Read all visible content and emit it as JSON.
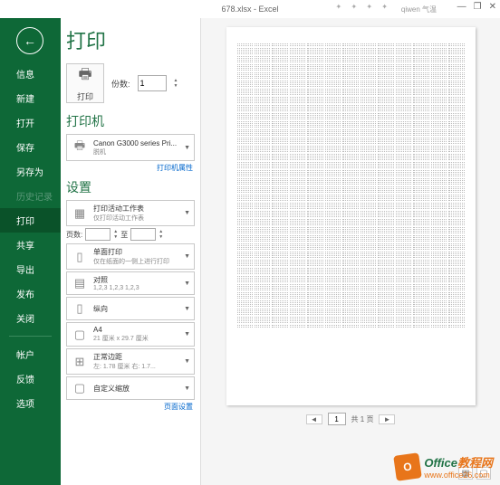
{
  "titlebar": {
    "filename": "678.xlsx - Excel",
    "user": "qiwen 气温"
  },
  "window": {
    "minimize": "—",
    "restore": "❐",
    "close": "✕"
  },
  "sidebar": {
    "items": [
      "信息",
      "新建",
      "打开",
      "保存",
      "另存为",
      "历史记录",
      "打印",
      "共享",
      "导出",
      "发布",
      "关闭"
    ],
    "bottom": [
      "帐户",
      "反馈",
      "选项"
    ]
  },
  "page": {
    "title": "打印"
  },
  "print": {
    "button_label": "打印",
    "copies_label": "份数:",
    "copies_value": "1"
  },
  "printer": {
    "section": "打印机",
    "name": "Canon G3000 series Pri...",
    "status": "脱机",
    "props_link": "打印机属性"
  },
  "settings": {
    "section": "设置",
    "active": {
      "l1": "打印活动工作表",
      "l2": "仅打印活动工作表"
    },
    "pages": {
      "label": "页数:",
      "to": "至"
    },
    "oneside": {
      "l1": "单面打印",
      "l2": "仅在纸面的一侧上进行打印"
    },
    "collate": {
      "l1": "对照",
      "l2": "1,2,3   1,2,3   1,2,3"
    },
    "orient": {
      "l1": "纵向"
    },
    "paper": {
      "l1": "A4",
      "l2": "21 厘米 x 29.7 厘米"
    },
    "margins": {
      "l1": "正常边距",
      "l2": "左: 1.78 厘米  右: 1.7..."
    },
    "scaling": {
      "l1": "自定义缩放"
    },
    "page_setup_link": "页面设置"
  },
  "pager": {
    "page": "1",
    "of_label": "共 1 页"
  },
  "watermark": {
    "line1_a": "Office",
    "line1_b": "教程网",
    "line2": "www.office26.com"
  }
}
